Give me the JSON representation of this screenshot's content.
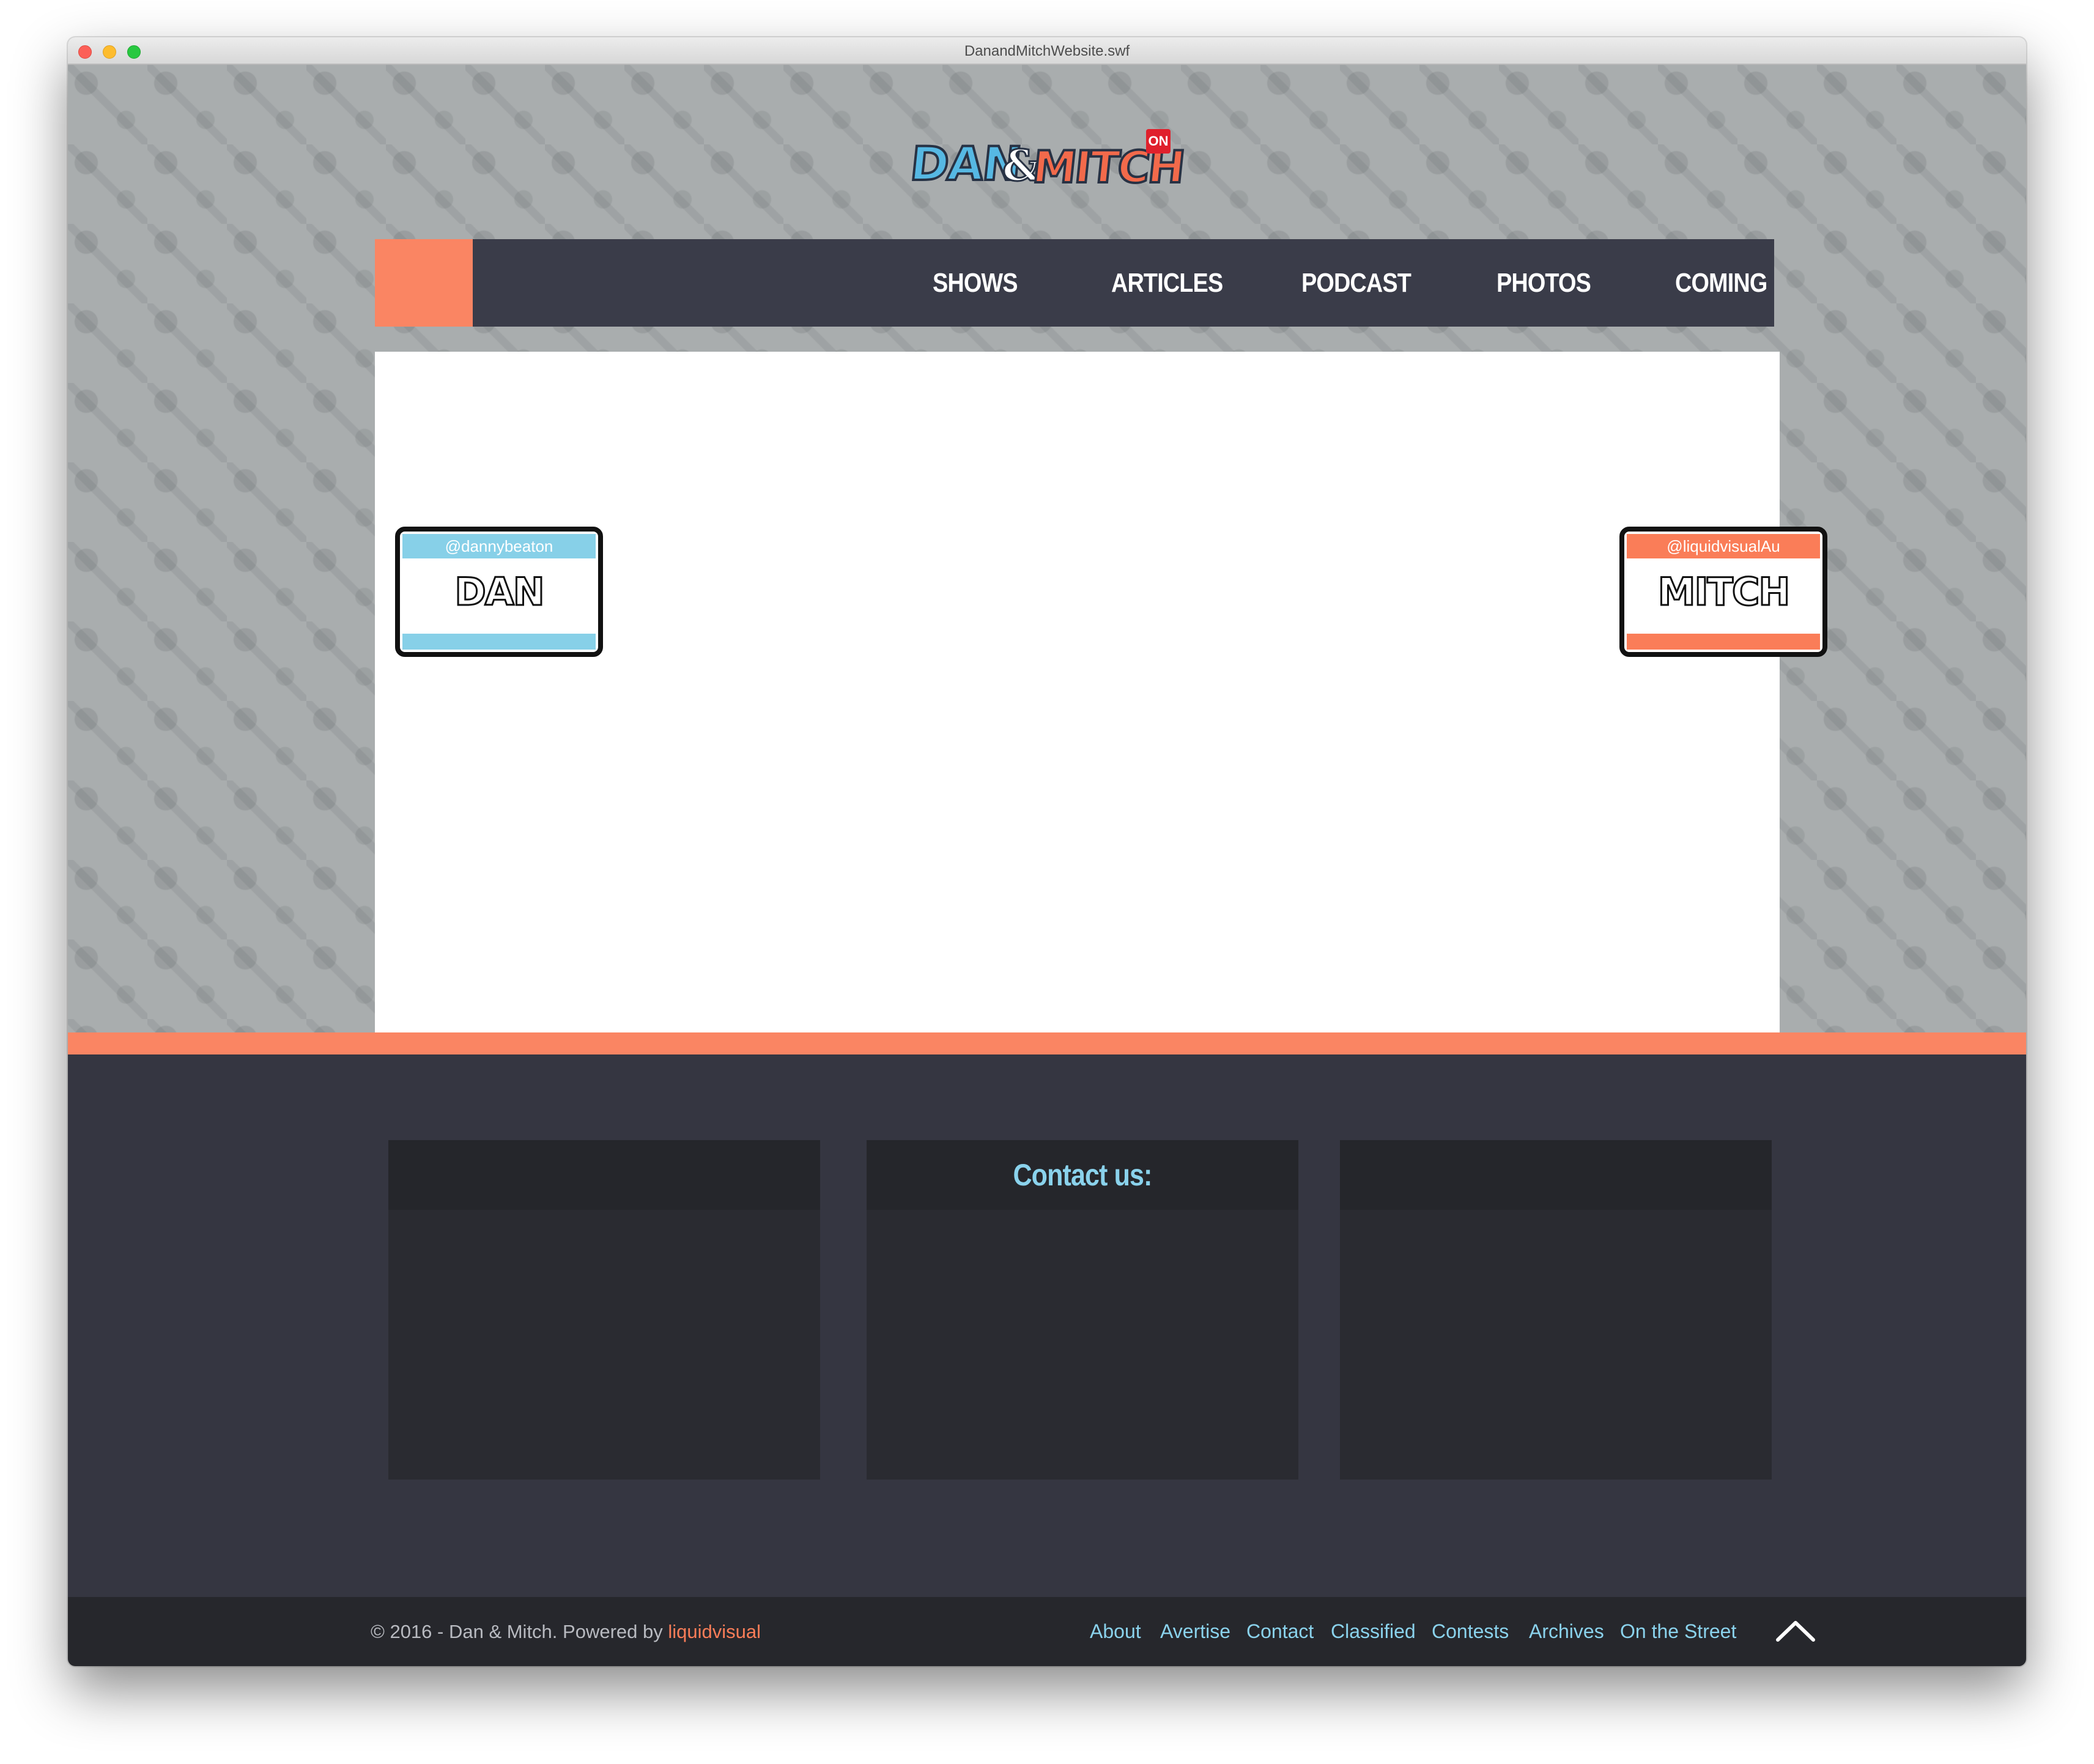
{
  "window": {
    "title": "DanandMitchWebsite.swf"
  },
  "logo": {
    "dan": "DAN",
    "amp": "&",
    "mitch": "MITCH",
    "on": "ON"
  },
  "nav": {
    "items": [
      {
        "label": "SHOWS"
      },
      {
        "label": "ARTICLES"
      },
      {
        "label": "PODCAST"
      },
      {
        "label": "PHOTOS"
      },
      {
        "label": "COMING UP"
      }
    ]
  },
  "badges": {
    "dan": {
      "handle": "@dannybeaton",
      "name": "DAN",
      "color": "#87d0e8"
    },
    "mitch": {
      "handle": "@liquidvisualAu",
      "name": "MITCH",
      "color": "#fa7d58"
    }
  },
  "footer": {
    "contact_title": "Contact us:",
    "copyright_prefix": "© 2016 - Dan & Mitch. Powered by ",
    "copyright_brand": "liquidvisual",
    "links": [
      {
        "label": "About"
      },
      {
        "label": "Avertise"
      },
      {
        "label": "Contact"
      },
      {
        "label": "Classified"
      },
      {
        "label": "Contests"
      },
      {
        "label": "Archives"
      },
      {
        "label": "On the Street"
      }
    ],
    "to_top_icon": "chevron-up-icon"
  },
  "colors": {
    "accent_orange": "#fa8563",
    "nav_dark": "#3a3c49",
    "link_blue": "#8ad2ec",
    "footer_dark": "#353641"
  }
}
